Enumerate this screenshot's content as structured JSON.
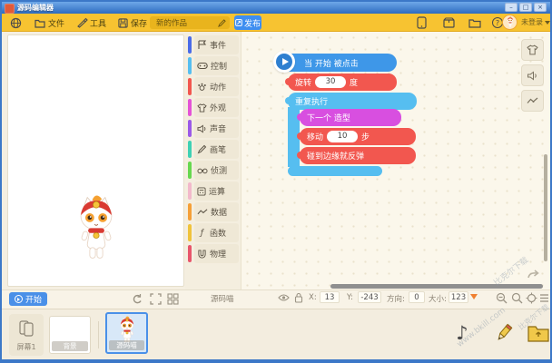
{
  "window": {
    "title": "源码编辑器",
    "controls": {
      "minimize": "–",
      "maximize": "□",
      "close": "×"
    }
  },
  "toolbar": {
    "file_label": "文件",
    "tools_label": "工具",
    "save_label": "保存",
    "project_name": "新的作品",
    "publish_label": "发布",
    "login_label": "未登录"
  },
  "palette": {
    "categories": [
      {
        "label": "事件",
        "color": "#4A6BE8"
      },
      {
        "label": "控制",
        "color": "#56BEF0"
      },
      {
        "label": "动作",
        "color": "#F2574F"
      },
      {
        "label": "外观",
        "color": "#E453D6"
      },
      {
        "label": "声音",
        "color": "#9B59E8"
      },
      {
        "label": "画笔",
        "color": "#3FD1B4"
      },
      {
        "label": "侦测",
        "color": "#67D84F"
      },
      {
        "label": "运算",
        "color": "#F2B9CB"
      },
      {
        "label": "数据",
        "color": "#F5A038"
      },
      {
        "label": "函数",
        "color": "#F0C33C"
      },
      {
        "label": "物理",
        "color": "#E8566B"
      }
    ]
  },
  "script": {
    "hat_label": "当 开始 被点击",
    "rotate_prefix": "旋转",
    "rotate_value": "30",
    "rotate_suffix": "度",
    "repeat_label": "重复执行",
    "next_costume_label": "下一个 造型",
    "move_prefix": "移动",
    "move_value": "10",
    "move_suffix": "步",
    "bounce_label": "碰到边缘就反弹",
    "colors": {
      "event": "#3E97E8",
      "motion": "#F2574F",
      "control": "#56BEF0",
      "looks": "#D84FE0"
    }
  },
  "stage": {
    "start_label": "开始"
  },
  "status": {
    "sprite_name": "源码喵",
    "x_label": "X:",
    "x_value": "13",
    "y_label": "Y:",
    "y_value": "-243",
    "dir_label": "方向:",
    "dir_value": "0",
    "size_label": "大小:",
    "size_value": "123"
  },
  "bottom": {
    "screen_label": "屏幕1",
    "background_label": "背景",
    "sprite_label": "源码喵"
  },
  "watermark": {
    "name": "比克尔下载",
    "site": "www.bkill.com"
  },
  "icons": {
    "help": "?",
    "fx": "ƒ",
    "music": "♪"
  }
}
